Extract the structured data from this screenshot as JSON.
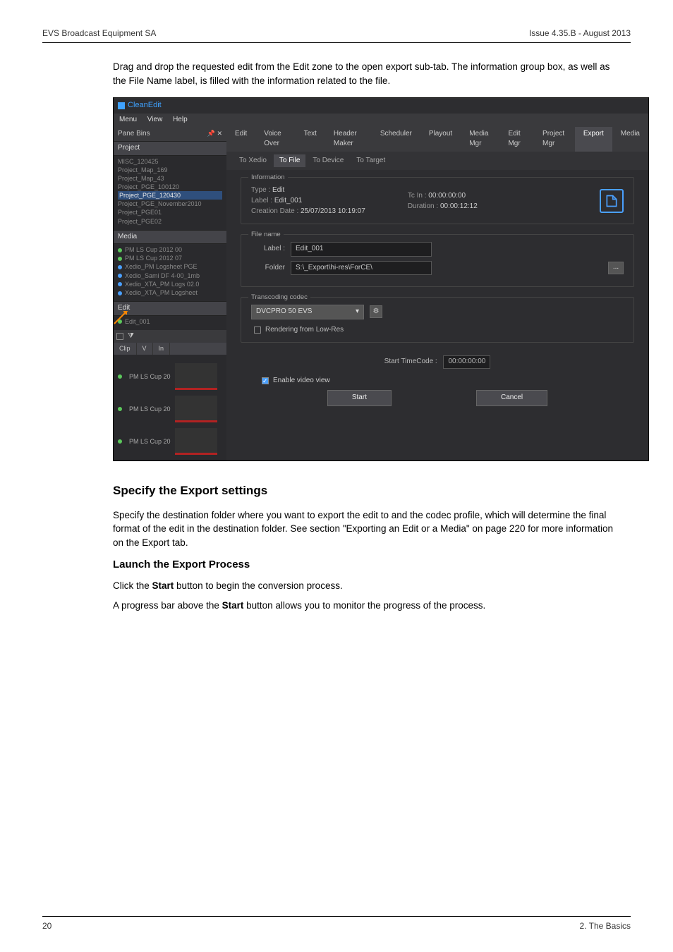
{
  "header": {
    "left": "EVS Broadcast Equipment SA",
    "right": "Issue 4.35.B - August 2013"
  },
  "intro": "Drag and drop the requested edit from the Edit zone to the open export sub-tab. The information group box, as well as the File Name label, is filled with the information related to the file.",
  "app": {
    "title": "CleanEdit",
    "menu": {
      "m1": "Menu",
      "m2": "View",
      "m3": "Help"
    },
    "pane_bins": "Pane Bins",
    "pin_glyph": "📌 ✕",
    "sections": {
      "project": "Project",
      "media": "Media",
      "edit": "Edit"
    },
    "projects": {
      "p1": "MISC_120425",
      "p2": "Project_Map_169",
      "p3": "Project_Map_43",
      "p4": "Project_PGE_100120",
      "p5": "Project_PGE_120430",
      "p6": "Project_PGE_November2010",
      "p7": "Project_PGE01",
      "p8": "Project_PGE02"
    },
    "media": {
      "m1": "PM LS Cup 2012 00",
      "m2": "PM LS Cup 2012 07",
      "m3": "Xedio_PM Logsheet PGE",
      "m4": "Xedio_Sami DF 4-00_1mb",
      "m5": "Xedio_XTA_PM Logs 02.0",
      "m6": "Xedio_XTA_PM Logsheet"
    },
    "edit": {
      "e1": "Edit_001"
    },
    "side_tbl": {
      "c1": "Clip",
      "c2": "V",
      "c3": "In"
    },
    "thumbs": {
      "t1": "PM LS Cup 20",
      "t2": "PM LS Cup 20",
      "t3": "PM LS Cup 20"
    },
    "tabs": {
      "t1": "Edit",
      "t2": "Voice Over",
      "t3": "Text",
      "t4": "Header Maker",
      "t5": "Scheduler",
      "t6": "Playout",
      "t7": "Media Mgr",
      "t8": "Edit Mgr",
      "t9": "Project Mgr",
      "t10": "Export",
      "t11": "Media"
    },
    "subtabs": {
      "s1": "To Xedio",
      "s2": "To File",
      "s3": "To Device",
      "s4": "To Target"
    },
    "info": {
      "title": "Information",
      "type_l": "Type :",
      "type_v": "Edit",
      "label_l": "Label :",
      "label_v": "Edit_001",
      "cdate_l": "Creation Date :",
      "cdate_v": "25/07/2013 10:19:07",
      "tcin_l": "Tc In :",
      "tcin_v": "00:00:00:00",
      "dur_l": "Duration :",
      "dur_v": "00:00:12:12"
    },
    "filename": {
      "title": "File name",
      "label_l": "Label :",
      "label_v": "Edit_001",
      "folder_l": "Folder",
      "folder_v": "S:\\_Export\\hi-res\\ForCE\\",
      "browse": "..."
    },
    "transcoding": {
      "title": "Transcoding codec",
      "codec": "DVCPRO 50 EVS",
      "render_chk": "Rendering from Low-Res"
    },
    "start_tc": {
      "lbl": "Start TimeCode :",
      "val": "00:00:00:00"
    },
    "enable_view": "Enable video view",
    "buttons": {
      "start": "Start",
      "cancel": "Cancel"
    }
  },
  "sec1": {
    "h": "Specify the Export settings",
    "p": "Specify the destination folder where you want to export the edit to and the codec profile, which will determine the final format of the edit in the destination folder. See section \"Exporting an Edit or a Media\" on page 220 for more information on the Export tab."
  },
  "sec2": {
    "h": "Launch the Export Process",
    "p1a": "Click the ",
    "p1b": "Start",
    "p1c": " button to begin the conversion process.",
    "p2a": "A progress bar above the ",
    "p2b": "Start",
    "p2c": " button allows you to monitor the progress of the process."
  },
  "footer": {
    "left": "20",
    "right": "2. The Basics"
  }
}
